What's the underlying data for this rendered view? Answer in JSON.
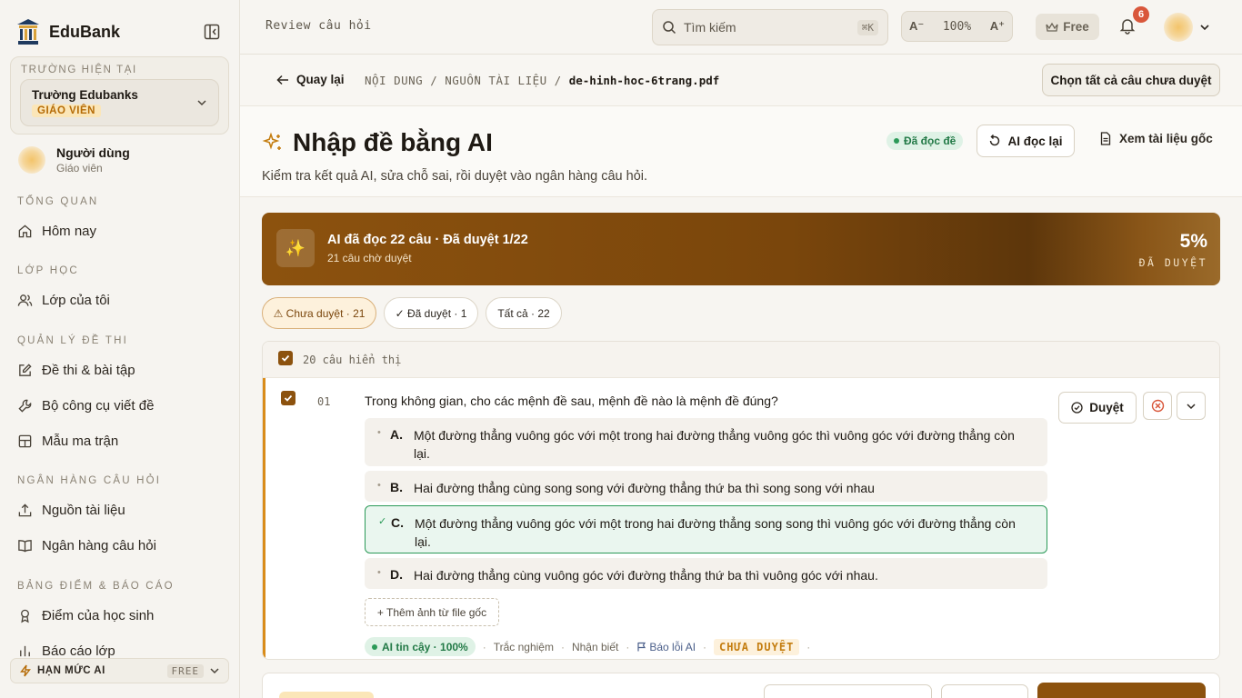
{
  "brand": {
    "name": "EduBank"
  },
  "school": {
    "caption": "TRƯỜNG HIỆN TẠI",
    "name": "Trường Edubanks",
    "role": "GIÁO VIÊN"
  },
  "user": {
    "name": "Người dùng",
    "role": "Giáo viên"
  },
  "sidebar": {
    "sections": [
      {
        "label": "TỔNG QUAN",
        "items": [
          {
            "label": "Hôm nay",
            "icon": "home-icon"
          }
        ]
      },
      {
        "label": "LỚP HỌC",
        "items": [
          {
            "label": "Lớp của tôi",
            "icon": "users-icon"
          }
        ]
      },
      {
        "label": "QUẢN LÝ ĐỀ THI",
        "items": [
          {
            "label": "Đề thi & bài tập",
            "icon": "edit-icon"
          },
          {
            "label": "Bộ công cụ viết đề",
            "icon": "wrench-icon"
          },
          {
            "label": "Mẫu ma trận",
            "icon": "grid-icon"
          }
        ]
      },
      {
        "label": "NGÂN HÀNG CÂU HỎI",
        "items": [
          {
            "label": "Nguồn tài liệu",
            "icon": "upload-icon"
          },
          {
            "label": "Ngân hàng câu hỏi",
            "icon": "book-icon"
          }
        ]
      },
      {
        "label": "BẢNG ĐIỂM & BÁO CÁO",
        "items": [
          {
            "label": "Điểm của học sinh",
            "icon": "award-icon"
          },
          {
            "label": "Báo cáo lớp",
            "icon": "chart-icon"
          }
        ]
      }
    ],
    "quota": {
      "label": "HẠN MỨC AI",
      "plan": "FREE"
    }
  },
  "topbar": {
    "title": "Review câu hỏi",
    "search_placeholder": "Tìm kiếm",
    "search_shortcut": "⌘K",
    "zoom_out": "A⁻",
    "zoom_level": "100%",
    "zoom_in": "A⁺",
    "plan": "Free",
    "notifications": "6"
  },
  "subbar": {
    "back": "Quay lại",
    "path_prefix": "NỘI DUNG / NGUỒN TÀI LIỆU / ",
    "path_file": "de-hinh-hoc-6trang.pdf",
    "select_all": "Chọn tất cả câu chưa duyệt"
  },
  "heading": {
    "title": "Nhập đề bằng AI",
    "subtitle": "Kiểm tra kết quả AI, sửa chỗ sai, rồi duyệt vào ngân hàng câu hỏi.",
    "status": "Đã đọc đề",
    "reread": "AI đọc lại",
    "source": "Xem tài liệu gốc"
  },
  "banner": {
    "title": "AI đã đọc 22 câu · Đã duyệt 1/22",
    "subtitle": "21 câu chờ duyệt",
    "percent": "5%",
    "percent_label": "ĐÃ DUYỆT",
    "progress": 0.05
  },
  "filters": [
    {
      "label": "⚠ Chưa duyệt · 21",
      "active": true
    },
    {
      "label": "✓ Đã duyệt · 1",
      "active": false
    },
    {
      "label": "Tất cả · 22",
      "active": false
    }
  ],
  "list": {
    "count_label": "20 câu hiển thị"
  },
  "question": {
    "number": "01",
    "text": "Trong không gian, cho các mệnh đề sau, mệnh đề nào là mệnh đề đúng?",
    "options": [
      {
        "letter": "A.",
        "text": "Một đường thẳng vuông góc với một trong hai đường thẳng vuông góc thì vuông góc với đường thẳng còn lại.",
        "correct": false
      },
      {
        "letter": "B.",
        "text": "Hai đường thẳng cùng song song với đường thẳng thứ ba thì song song với nhau",
        "correct": false
      },
      {
        "letter": "C.",
        "text": "Một đường thẳng vuông góc với một trong hai đường thẳng song song thì vuông góc với đường thẳng còn lại.",
        "correct": true
      },
      {
        "letter": "D.",
        "text": "Hai đường thẳng cùng vuông góc với đường thẳng thứ ba thì vuông góc với nhau.",
        "correct": false
      }
    ],
    "add_image": "+ Thêm ảnh từ file gốc",
    "confidence": "AI tin cậy · 100%",
    "type": "Trắc nghiệm",
    "level": "Nhận biết",
    "report": "Báo lỗi AI",
    "status": "CHƯA DUYỆT",
    "approve": "Duyệt"
  },
  "colors": {
    "accent": "#8c520e",
    "warning": "#d98c1a",
    "success": "#2b9a58",
    "danger": "#d9573b"
  }
}
